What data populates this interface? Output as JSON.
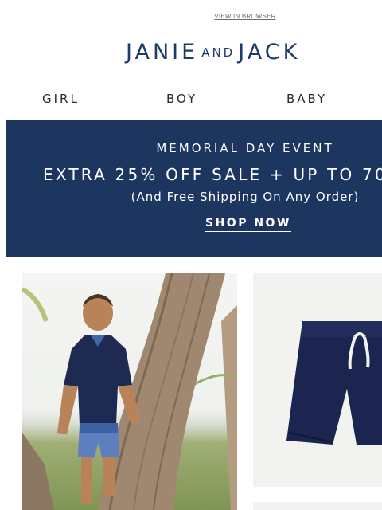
{
  "header": {
    "view_in_browser": "VIEW IN BROWSER",
    "logo_part1": "JANIE",
    "logo_and": "AND",
    "logo_part2": "JACK"
  },
  "nav": {
    "items": [
      {
        "label": "GIRL"
      },
      {
        "label": "BOY"
      },
      {
        "label": "BABY"
      }
    ]
  },
  "banner": {
    "event": "MEMORIAL DAY EVENT",
    "offer": "EXTRA 25% OFF SALE + UP TO 70",
    "shipping": "(And Free Shipping On Any Order)",
    "cta": "SHOP NOW",
    "background_color": "#1c365f"
  },
  "products": {
    "left_image": "boy-by-palm-tree-photo",
    "right_image": "navy-pull-on-shorts-photo"
  }
}
